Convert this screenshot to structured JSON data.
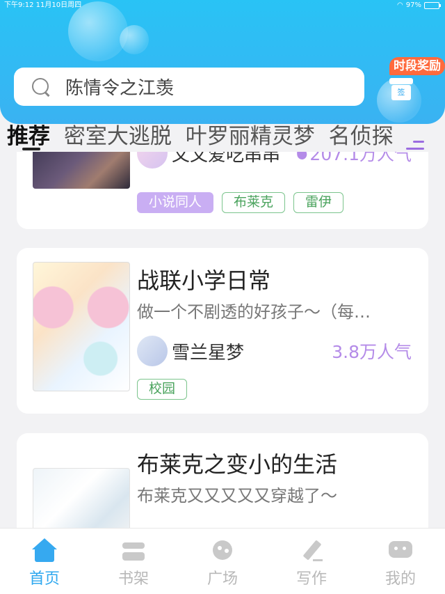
{
  "status_bar": {
    "time_date": "下午9:12   11月10日周四",
    "battery": "97%",
    "battery_level": 0.97
  },
  "search": {
    "placeholder": "陈情令之江羡"
  },
  "reward_badge": "时段奖励",
  "sign_in_label": "签",
  "tabs": [
    "推荐",
    "密室大逃脱",
    "叶罗丽精灵梦",
    "名侦探"
  ],
  "cards": [
    {
      "author": "文文爱吃串串",
      "popularity": "207.1万人气",
      "tags": [
        "小说同人",
        "布莱克",
        "雷伊"
      ]
    },
    {
      "title": "战联小学日常",
      "description": "做一个不剧透的好孩子～（每…",
      "author": "雪兰星梦",
      "popularity": "3.8万人气",
      "tags": [
        "校园"
      ]
    },
    {
      "title": "布莱克之变小的生活",
      "description": "布莱克又又又又又穿越了～"
    }
  ],
  "tabbar": [
    {
      "label": "首页",
      "icon": "home-icon",
      "active": true
    },
    {
      "label": "书架",
      "icon": "bookshelf-icon"
    },
    {
      "label": "广场",
      "icon": "plaza-icon"
    },
    {
      "label": "写作",
      "icon": "write-icon"
    },
    {
      "label": "我的",
      "icon": "profile-icon"
    }
  ],
  "colors": {
    "header": "#29c3f5",
    "accent": "#2fa8ef",
    "popularity": "#b48be8",
    "tag_green": "#4aa35d",
    "tag_purple": "#c9aef3"
  }
}
